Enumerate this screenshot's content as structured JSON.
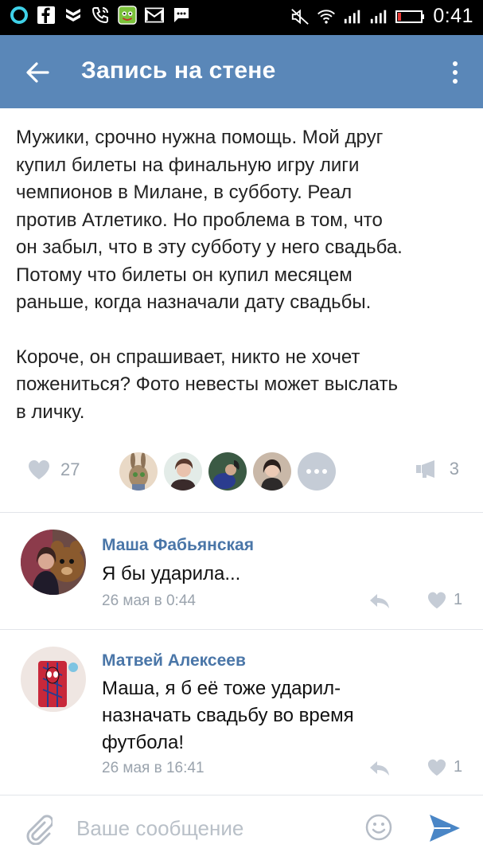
{
  "status_bar": {
    "time": "0:41",
    "icons": [
      "ring-icon",
      "facebook-icon",
      "shield-icon",
      "phone-icon",
      "game-icon",
      "mail-icon",
      "chat-icon",
      "mute-icon",
      "wifi-icon",
      "signal-icon",
      "signal-icon",
      "battery-icon"
    ]
  },
  "app_bar": {
    "title": "Запись на стене",
    "back_icon": "arrow-left-icon",
    "menu_icon": "more-vert-icon"
  },
  "post": {
    "paragraphs": [
      "Мужики, срочно нужна помощь. Мой друг\nкупил билеты на финальную игру лиги\nчемпионов в Милане, в субботу. Реал\nпротив Атлетико. Но проблема в том, что\nон забыл, что в эту субботу у него свадьба.\nПотому что  билеты он купил месяцем\nраньше, когда назначали дату свадьбы.",
      "Короче, он спрашивает, никто не хочет\nпожениться? Фото невесты может выслать\nв личку."
    ],
    "likes_count": "27",
    "shares_count": "3"
  },
  "comments": [
    {
      "author": "Маша Фабьянская",
      "text": "Я бы ударила...",
      "date": "26 мая в 0:44",
      "likes": "1"
    },
    {
      "author": "Матвей Алексеев",
      "text": "Маша, я б её тоже ударил-\nназначать свадьбу во время\nфутбола!",
      "date": "26 мая в 16:41",
      "likes": "1"
    }
  ],
  "composer": {
    "placeholder": "Ваше сообщение"
  },
  "colors": {
    "app_bar": "#5a87b8",
    "author_link": "#4a76a8",
    "muted": "#9aa3ad",
    "send": "#4a86c6"
  }
}
